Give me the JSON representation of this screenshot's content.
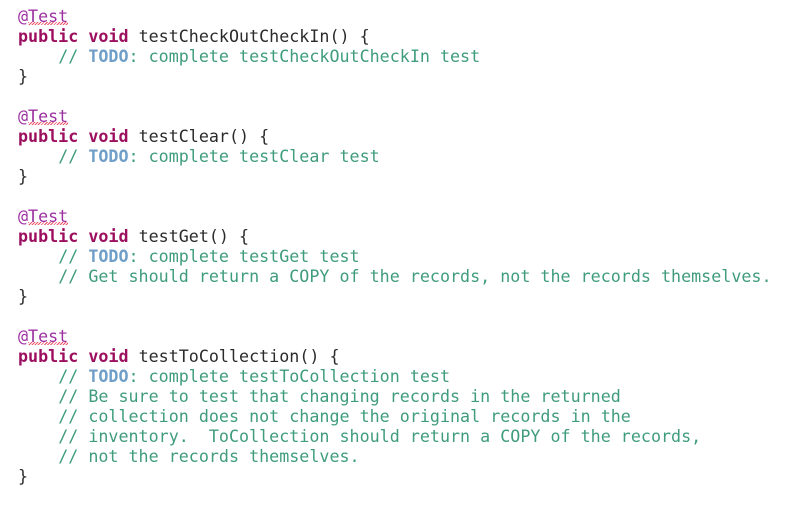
{
  "editor": {
    "background_color": "#ffffff",
    "language": "java",
    "colors": {
      "annotation": "#9b30a0",
      "keyword": "#9c0f5f",
      "identifier": "#2b2b2b",
      "comment": "#3f9c7c",
      "todo": "#6f9fc8",
      "squiggle": "#e8495f"
    },
    "lines": [
      {
        "id": "l1",
        "type": "annotation",
        "at": "@",
        "name": "Test",
        "indent": 0,
        "squiggle": true
      },
      {
        "id": "l2",
        "type": "signature",
        "indent": 0,
        "keywords": "public void ",
        "method": "testCheckOutCheckIn",
        "tail": "() {"
      },
      {
        "id": "l3",
        "type": "comment-todo",
        "indent": 4,
        "slashes": "// ",
        "todo": "TODO",
        "rest": ": complete testCheckOutCheckIn test"
      },
      {
        "id": "l4",
        "type": "brace",
        "indent": 0,
        "text": "}"
      },
      {
        "id": "l5",
        "type": "blank",
        "indent": 0,
        "text": ""
      },
      {
        "id": "l6",
        "type": "annotation",
        "at": "@",
        "name": "Test",
        "indent": 0,
        "squiggle": true
      },
      {
        "id": "l7",
        "type": "signature",
        "indent": 0,
        "keywords": "public void ",
        "method": "testClear",
        "tail": "() {"
      },
      {
        "id": "l8",
        "type": "comment-todo",
        "indent": 4,
        "slashes": "// ",
        "todo": "TODO",
        "rest": ": complete testClear test"
      },
      {
        "id": "l9",
        "type": "brace",
        "indent": 0,
        "text": "}"
      },
      {
        "id": "l10",
        "type": "blank",
        "indent": 0,
        "text": ""
      },
      {
        "id": "l11",
        "type": "annotation",
        "at": "@",
        "name": "Test",
        "indent": 0,
        "squiggle": true
      },
      {
        "id": "l12",
        "type": "signature",
        "indent": 0,
        "keywords": "public void ",
        "method": "testGet",
        "tail": "() {"
      },
      {
        "id": "l13",
        "type": "comment-todo",
        "indent": 4,
        "slashes": "// ",
        "todo": "TODO",
        "rest": ": complete testGet test"
      },
      {
        "id": "l14",
        "type": "comment",
        "indent": 4,
        "text": "// Get should return a COPY of the records, not the records themselves."
      },
      {
        "id": "l15",
        "type": "brace",
        "indent": 0,
        "text": "}"
      },
      {
        "id": "l16",
        "type": "blank",
        "indent": 0,
        "text": ""
      },
      {
        "id": "l17",
        "type": "annotation",
        "at": "@",
        "name": "Test",
        "indent": 0,
        "squiggle": true
      },
      {
        "id": "l18",
        "type": "signature",
        "indent": 0,
        "keywords": "public void ",
        "method": "testToCollection",
        "tail": "() {"
      },
      {
        "id": "l19",
        "type": "comment-todo",
        "indent": 4,
        "slashes": "// ",
        "todo": "TODO",
        "rest": ": complete testToCollection test"
      },
      {
        "id": "l20",
        "type": "comment",
        "indent": 4,
        "text": "// Be sure to test that changing records in the returned"
      },
      {
        "id": "l21",
        "type": "comment",
        "indent": 4,
        "text": "// collection does not change the original records in the"
      },
      {
        "id": "l22",
        "type": "comment",
        "indent": 4,
        "text": "// inventory.  ToCollection should return a COPY of the records,"
      },
      {
        "id": "l23",
        "type": "comment",
        "indent": 4,
        "text": "// not the records themselves."
      },
      {
        "id": "l24",
        "type": "brace",
        "indent": 0,
        "text": "}"
      }
    ]
  }
}
